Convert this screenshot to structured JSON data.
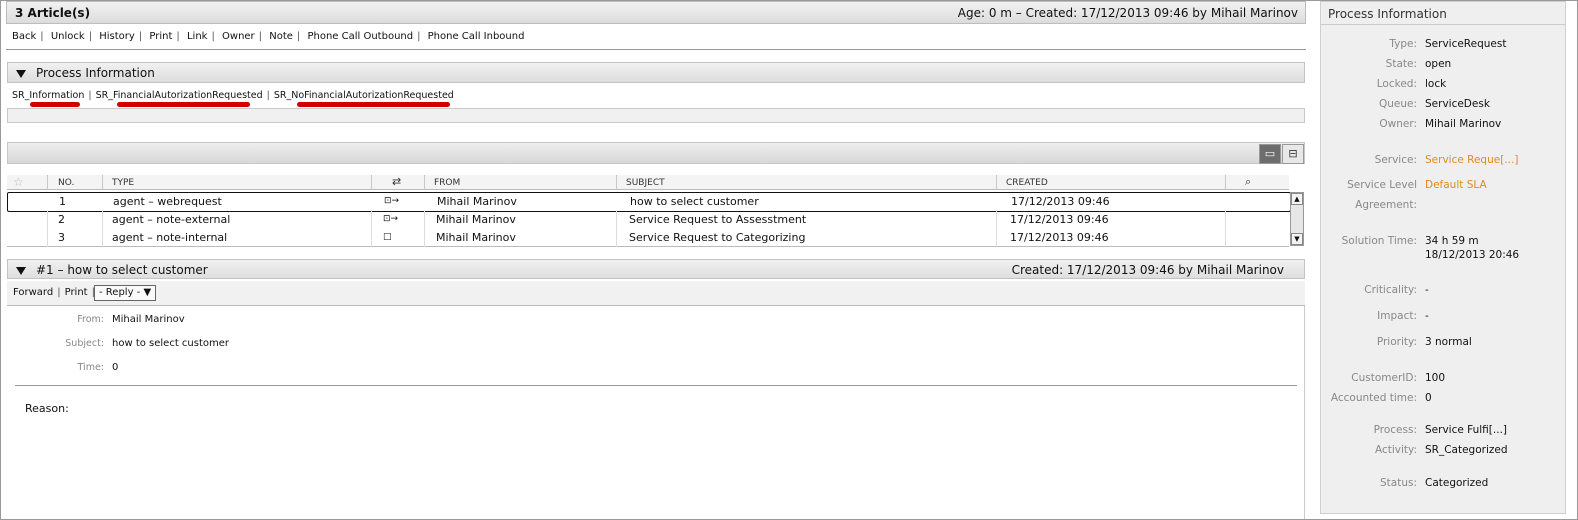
{
  "header": {
    "articles_title": "3 Article(s)",
    "age_created": "Age: 0 m – Created: 17/12/2013 09:46 by Mihail Marinov"
  },
  "actions": [
    "Back",
    "Unlock",
    "History",
    "Print",
    "Link",
    "Owner",
    "Note",
    "Phone Call Outbound",
    "Phone Call Inbound"
  ],
  "process_box": {
    "title": "Process Information",
    "tabs": [
      "SR_Information",
      "SR_FinancialAutorizationRequested",
      "SR_NoFinancialAutorizationRequested"
    ]
  },
  "table": {
    "columns": [
      "NO.",
      "TYPE",
      "FROM",
      "SUBJECT",
      "CREATED"
    ],
    "rows": [
      {
        "no": "1",
        "type": "agent – webrequest",
        "dir": "⊡→",
        "from": "Mihail Marinov",
        "subject": "how to select customer",
        "created": "17/12/2013 09:46"
      },
      {
        "no": "2",
        "type": "agent – note-external",
        "dir": "⊡→",
        "from": "Mihail Marinov",
        "subject": "Service Request to Assesstment",
        "created": "17/12/2013 09:46"
      },
      {
        "no": "3",
        "type": "agent – note-internal",
        "dir": "□",
        "from": "Mihail Marinov",
        "subject": "Service Request to Categorizing",
        "created": "17/12/2013 09:46"
      }
    ]
  },
  "article": {
    "title": "#1 – how to select customer",
    "created": "Created: 17/12/2013 09:46 by Mihail Marinov",
    "forward": "Forward",
    "print": "Print",
    "reply": "- Reply -",
    "from_label": "From:",
    "from_value": "Mihail Marinov",
    "subject_label": "Subject:",
    "subject_value": "how to select customer",
    "time_label": "Time:",
    "time_value": "0",
    "body": "Reason:"
  },
  "sidebar": {
    "title": "Process Information",
    "type_label": "Type:",
    "type_value": "ServiceRequest",
    "state_label": "State:",
    "state_value": "open",
    "locked_label": "Locked:",
    "locked_value": "lock",
    "queue_label": "Queue:",
    "queue_value": "ServiceDesk",
    "owner_label": "Owner:",
    "owner_value": "Mihail Marinov",
    "service_label": "Service:",
    "service_value": "Service Reque[...]",
    "sla_label1": "Service Level",
    "sla_label2": "Agreement:",
    "sla_value": "Default SLA",
    "solution_label": "Solution Time:",
    "solution_value1": "34 h 59 m",
    "solution_value2": "18/12/2013 20:46",
    "criticality_label": "Criticality:",
    "criticality_value": "-",
    "impact_label": "Impact:",
    "impact_value": "-",
    "priority_label": "Priority:",
    "priority_value": "3 normal",
    "customerid_label": "CustomerID:",
    "customerid_value": "100",
    "accounted_label": "Accounted time:",
    "accounted_value": "0",
    "process_label": "Process:",
    "process_value": "Service Fulfi[...]",
    "activity_label": "Activity:",
    "activity_value": "SR_Categorized",
    "status_label": "Status:",
    "status_value": "Categorized"
  },
  "colors": {
    "link": "#e08a1e",
    "annotation": "#d10000"
  }
}
